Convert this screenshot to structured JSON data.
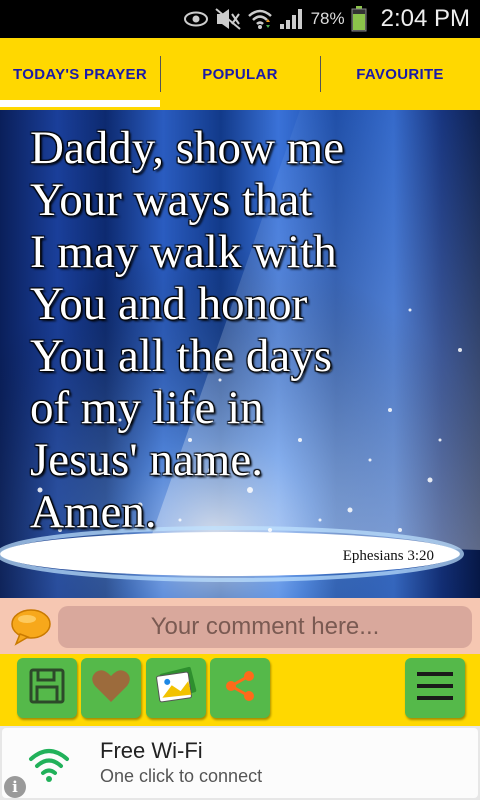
{
  "status_bar": {
    "battery_percent": "78%",
    "time": "2:04 PM",
    "icons": [
      "eye-icon",
      "mute-icon",
      "wifi-icon",
      "signal-icon",
      "battery-icon"
    ]
  },
  "tabs": [
    {
      "label": "TODAY'S PRAYER",
      "active": true
    },
    {
      "label": "POPULAR",
      "active": false
    },
    {
      "label": "FAVOURITE",
      "active": false
    }
  ],
  "prayer": {
    "text": "Daddy, show me\nYour ways that\nI may walk with\nYou and honor\nYou all the days\nof my life in\nJesus' name.\nAmen.",
    "reference": "Ephesians 3:20"
  },
  "comment": {
    "placeholder": "Your comment here...",
    "icon": "speech-bubble-icon"
  },
  "toolbar": {
    "buttons": [
      "save-icon",
      "heart-icon",
      "wallpaper-icon",
      "share-icon",
      "menu-icon"
    ]
  },
  "ad": {
    "title": "Free Wi-Fi",
    "subtitle": "One click to connect",
    "icon": "wifi-icon"
  },
  "colors": {
    "accent_yellow": "#ffd800",
    "tab_text": "#1a1aa8",
    "button_green": "#55b94a",
    "comment_bg": "#f6c7b2"
  }
}
